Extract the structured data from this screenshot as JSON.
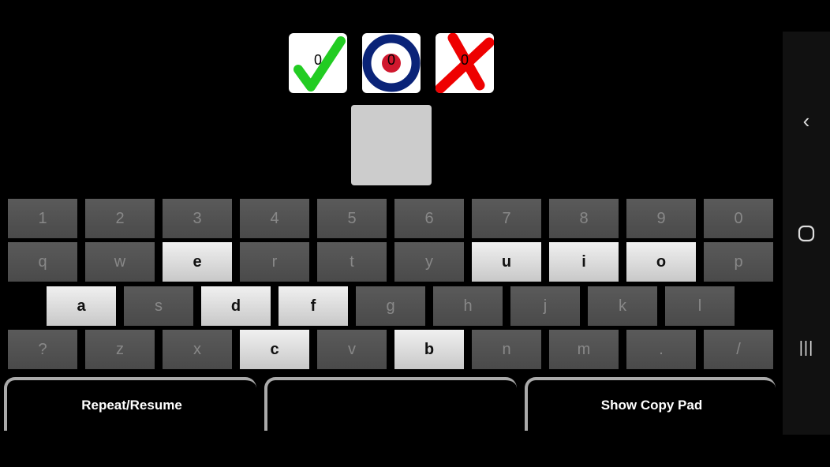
{
  "scores": {
    "correct": "0",
    "target": "0",
    "wrong": "0"
  },
  "rows": [
    [
      {
        "k": "1",
        "on": false
      },
      {
        "k": "2",
        "on": false
      },
      {
        "k": "3",
        "on": false
      },
      {
        "k": "4",
        "on": false
      },
      {
        "k": "5",
        "on": false
      },
      {
        "k": "6",
        "on": false
      },
      {
        "k": "7",
        "on": false
      },
      {
        "k": "8",
        "on": false
      },
      {
        "k": "9",
        "on": false
      },
      {
        "k": "0",
        "on": false
      }
    ],
    [
      {
        "k": "q",
        "on": false
      },
      {
        "k": "w",
        "on": false
      },
      {
        "k": "e",
        "on": true
      },
      {
        "k": "r",
        "on": false
      },
      {
        "k": "t",
        "on": false
      },
      {
        "k": "y",
        "on": false
      },
      {
        "k": "u",
        "on": true
      },
      {
        "k": "i",
        "on": true
      },
      {
        "k": "o",
        "on": true
      },
      {
        "k": "p",
        "on": false
      }
    ],
    [
      {
        "k": "a",
        "on": true
      },
      {
        "k": "s",
        "on": false
      },
      {
        "k": "d",
        "on": true
      },
      {
        "k": "f",
        "on": true
      },
      {
        "k": "g",
        "on": false
      },
      {
        "k": "h",
        "on": false
      },
      {
        "k": "j",
        "on": false
      },
      {
        "k": "k",
        "on": false
      },
      {
        "k": "l",
        "on": false
      }
    ],
    [
      {
        "k": "?",
        "on": false
      },
      {
        "k": "z",
        "on": false
      },
      {
        "k": "x",
        "on": false
      },
      {
        "k": "c",
        "on": true
      },
      {
        "k": "v",
        "on": false
      },
      {
        "k": "b",
        "on": true
      },
      {
        "k": "n",
        "on": false
      },
      {
        "k": "m",
        "on": false
      },
      {
        "k": ".",
        "on": false
      },
      {
        "k": "/",
        "on": false
      }
    ]
  ],
  "buttons": {
    "repeat": "Repeat/Resume",
    "middle": "",
    "copy_pad": "Show Copy Pad"
  },
  "nav": {
    "back": "back-icon",
    "home": "home-icon",
    "recents": "recents-icon"
  },
  "colors": {
    "correct": "#22cc22",
    "target_ring": "#0a2378",
    "target_center": "#d0182e",
    "wrong": "#ee0000"
  }
}
